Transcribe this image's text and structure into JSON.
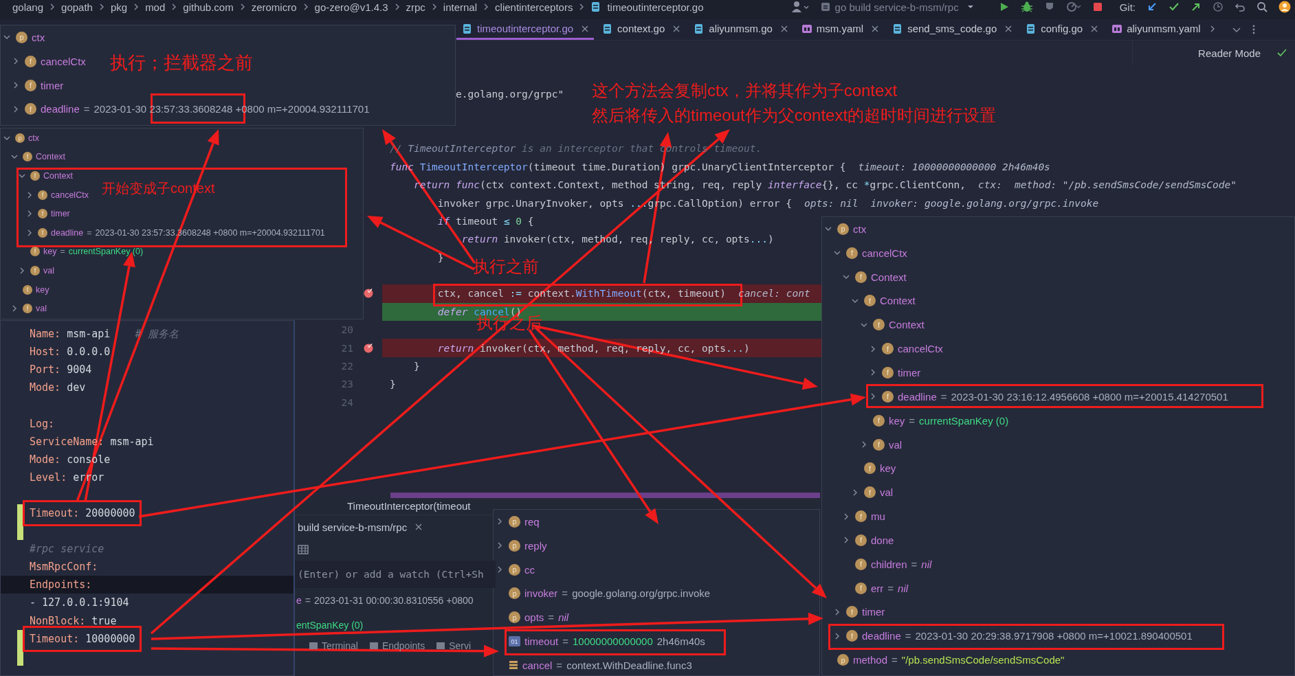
{
  "breadcrumb": [
    {
      "label": "golang",
      "kind": "dir"
    },
    {
      "label": "gopath",
      "kind": "dir"
    },
    {
      "label": "pkg",
      "kind": "dir"
    },
    {
      "label": "mod",
      "kind": "dir"
    },
    {
      "label": "github.com",
      "kind": "dir"
    },
    {
      "label": "zeromicro",
      "kind": "dir"
    },
    {
      "label": "go-zero@v1.4.3",
      "kind": "dir"
    },
    {
      "label": "zrpc",
      "kind": "dir"
    },
    {
      "label": "internal",
      "kind": "dir"
    },
    {
      "label": "clientinterceptors",
      "kind": "dir"
    },
    {
      "label": "timeoutinterceptor.go",
      "kind": "file"
    }
  ],
  "toolbar": {
    "run_config": "go build service-b-msm/rpc",
    "vcs_label": "Git:"
  },
  "tabs": [
    {
      "label": "timeoutinterceptor.go",
      "kind": "go",
      "selected": true,
      "closable": true
    },
    {
      "label": "context.go",
      "kind": "go",
      "selected": false,
      "closable": true
    },
    {
      "label": "aliyunmsm.go",
      "kind": "go",
      "selected": false,
      "closable": true
    },
    {
      "label": "msm.yaml",
      "kind": "yaml",
      "selected": false,
      "closable": true
    },
    {
      "label": "send_sms_code.go",
      "kind": "go",
      "selected": false,
      "closable": true
    },
    {
      "label": "config.go",
      "kind": "go",
      "selected": false,
      "closable": true
    },
    {
      "label": "aliyunmsm.yaml",
      "kind": "yaml",
      "selected": false,
      "closable": false
    }
  ],
  "reader_mode": "Reader Mode",
  "code_lines": [
    {
      "tokens": [
        {
          "text": "           e.golang.org/grpc\"",
          "kind": "p"
        }
      ],
      "breakpoint": false,
      "current": false
    },
    {
      "breakpoint": false,
      "current": false
    },
    {
      "breakpoint": false,
      "current": false
    },
    {
      "tokens": [
        {
          "text": "// ",
          "kind": "c"
        },
        {
          "text": "TimeoutInterceptor",
          "kind": "cd"
        },
        {
          "text": " is an interceptor that controls timeout.",
          "kind": "c"
        }
      ],
      "breakpoint": false,
      "current": false
    },
    {
      "tokens": [
        {
          "text": "func ",
          "kind": "kw"
        },
        {
          "text": "TimeoutInterceptor",
          "kind": "fn"
        },
        {
          "text": "(timeout time.Duration) grpc.UnaryClientInterceptor {",
          "kind": "p"
        }
      ],
      "hints": [
        "timeout: 10000000000000 2h46m40s"
      ],
      "breakpoint": false,
      "current": false
    },
    {
      "tokens": [
        {
          "text": "    return func",
          "kind": "kw"
        },
        {
          "text": "(ctx context.Context, method string, req, reply ",
          "kind": "p"
        },
        {
          "text": "interface",
          "kind": "kw"
        },
        {
          "text": "{}, cc ",
          "kind": "p"
        },
        {
          "text": "*",
          "kind": "op"
        },
        {
          "text": "grpc.ClientConn,",
          "kind": "p"
        }
      ],
      "hints": [
        "ctx:",
        "method: \"/pb.sendSmsCode/sendSmsCode\""
      ],
      "breakpoint": false,
      "current": false
    },
    {
      "tokens": [
        {
          "text": "        invoker grpc.UnaryInvoker, opts ",
          "kind": "p"
        },
        {
          "text": "...",
          "kind": "op"
        },
        {
          "text": "grpc.CallOption) error {",
          "kind": "p"
        }
      ],
      "hints": [
        "opts: nil",
        "invoker: google.golang.org/grpc.invoke"
      ],
      "breakpoint": false,
      "current": false
    },
    {
      "tokens": [
        {
          "text": "        if",
          "kind": "kw"
        },
        {
          "text": " timeout ",
          "kind": "p"
        },
        {
          "text": "≤",
          "kind": "op"
        },
        {
          "text": " 0",
          "kind": "num"
        },
        {
          "text": " {",
          "kind": "p"
        }
      ],
      "breakpoint": false,
      "current": false
    },
    {
      "tokens": [
        {
          "text": "            return",
          "kind": "kw"
        },
        {
          "text": " invoker(ctx, method, req, reply, cc, opts",
          "kind": "p"
        },
        {
          "text": "...",
          "kind": "op"
        },
        {
          "text": ")",
          "kind": "p"
        }
      ],
      "breakpoint": false,
      "current": false
    },
    {
      "tokens": [
        {
          "text": "        }",
          "kind": "p"
        }
      ],
      "breakpoint": false,
      "current": false
    },
    {
      "breakpoint": false,
      "current": false
    },
    {
      "tokens": [
        {
          "text": "        ctx, cancel ",
          "kind": "p"
        },
        {
          "text": ":=",
          "kind": "op"
        },
        {
          "text": " context.",
          "kind": "p"
        },
        {
          "text": "WithTimeout",
          "kind": "fn"
        },
        {
          "text": "(ctx, timeout)",
          "kind": "p"
        }
      ],
      "hints": [
        "cancel: cont"
      ],
      "breakpoint": true,
      "current": false
    },
    {
      "tokens": [
        {
          "text": "        defer ",
          "kind": "kw"
        },
        {
          "text": "cancel",
          "kind": "call"
        },
        {
          "text": "()",
          "kind": "p"
        }
      ],
      "breakpoint": false,
      "current": true
    },
    {
      "number": "20",
      "breakpoint": false,
      "current": false
    },
    {
      "number": "21",
      "tokens": [
        {
          "text": "        return",
          "kind": "kw"
        },
        {
          "text": " invoker(ctx, method, req, reply, cc, opts",
          "kind": "p"
        },
        {
          "text": "...",
          "kind": "op"
        },
        {
          "text": ")",
          "kind": "p"
        }
      ],
      "breakpoint": true,
      "current": false
    },
    {
      "number": "22",
      "tokens": [
        {
          "text": "    }",
          "kind": "p"
        }
      ],
      "breakpoint": false,
      "current": false
    },
    {
      "number": "23",
      "tokens": [
        {
          "text": "}",
          "kind": "p"
        }
      ],
      "breakpoint": false,
      "current": false
    },
    {
      "number": "24",
      "breakpoint": false,
      "current": false
    }
  ],
  "variable_panels": [
    {
      "items": [
        {
          "name": "ctx",
          "badge": "p",
          "kind": "round",
          "expanded": true,
          "children": [
            {
              "name": "cancelCtx",
              "badge": "f",
              "kind": "round",
              "expanded": false
            },
            {
              "name": "timer",
              "badge": "f",
              "kind": "round",
              "expanded": false
            },
            {
              "name": "deadline",
              "badge": "f",
              "kind": "round",
              "expanded": false,
              "value": [
                {
                  "text": "=",
                  "kind": "op"
                },
                {
                  "text": "2023-01-30 23:57:33.3608248 +0800 m=+20004.932111701",
                  "kind": "text"
                }
              ]
            }
          ]
        }
      ]
    },
    {
      "items": [
        {
          "name": "ctx",
          "badge": "p",
          "kind": "round",
          "expanded": true,
          "children": [
            {
              "name": "Context",
              "badge": "f",
              "kind": "round",
              "expanded": true,
              "children": [
                {
                  "name": "Context",
                  "badge": "f",
                  "kind": "round",
                  "expanded": true,
                  "children": [
                    {
                      "name": "cancelCtx",
                      "badge": "f",
                      "kind": "round",
                      "expanded": false
                    },
                    {
                      "name": "timer",
                      "badge": "f",
                      "kind": "round",
                      "expanded": false
                    },
                    {
                      "name": "deadline",
                      "badge": "f",
                      "kind": "round",
                      "expanded": false,
                      "value": [
                        {
                          "text": "=",
                          "kind": "op"
                        },
                        {
                          "text": "2023-01-30 23:57:33.3608248 +0800 m=+20004.932111701",
                          "kind": "text"
                        }
                      ]
                    }
                  ]
                },
                {
                  "name": "key",
                  "badge": "f",
                  "kind": "round",
                  "value": [
                    {
                      "text": "=",
                      "kind": "op"
                    },
                    {
                      "text": "currentSpanKey (0)",
                      "kind": "const"
                    }
                  ]
                },
                {
                  "name": "val",
                  "badge": "f",
                  "kind": "round",
                  "expanded": false
                }
              ]
            },
            {
              "name": "key",
              "badge": "f",
              "kind": "round"
            },
            {
              "name": "val",
              "badge": "f",
              "kind": "round",
              "expanded": false
            }
          ]
        }
      ]
    },
    {
      "items": [
        {
          "name": "req",
          "badge": "p",
          "kind": "round",
          "expanded": false
        },
        {
          "name": "reply",
          "badge": "p",
          "kind": "round",
          "expanded": false
        },
        {
          "name": "cc",
          "badge": "p",
          "kind": "round",
          "expanded": false
        },
        {
          "name": "invoker",
          "badge": "p",
          "kind": "round",
          "value": [
            {
              "text": "=",
              "kind": "op"
            },
            {
              "text": "google.golang.org/grpc.invoke",
              "kind": "text"
            }
          ]
        },
        {
          "name": "opts",
          "badge": "p",
          "kind": "round",
          "value": [
            {
              "text": "=",
              "kind": "op"
            },
            {
              "text": "nil",
              "kind": "nil"
            }
          ]
        },
        {
          "name": "timeout",
          "badge": "01",
          "kind": "square",
          "value": [
            {
              "text": "=",
              "kind": "op"
            },
            {
              "text": "10000000000000",
              "kind": "const"
            },
            {
              "text": "2h46m40s",
              "kind": "text"
            }
          ]
        },
        {
          "name": "cancel",
          "kind": "stack",
          "value": [
            {
              "text": "=",
              "kind": "op"
            },
            {
              "text": "context.WithDeadline.func3",
              "kind": "text"
            }
          ]
        }
      ]
    },
    {
      "items": [
        {
          "name": "ctx",
          "badge": "p",
          "kind": "round",
          "expanded": true,
          "children": [
            {
              "name": "cancelCtx",
              "badge": "f",
              "kind": "round",
              "expanded": true,
              "children": [
                {
                  "name": "Context",
                  "badge": "f",
                  "kind": "round",
                  "expanded": true,
                  "children": [
                    {
                      "name": "Context",
                      "badge": "f",
                      "kind": "round",
                      "expanded": true,
                      "children": [
                        {
                          "name": "Context",
                          "badge": "f",
                          "kind": "round",
                          "expanded": true,
                          "children": [
                            {
                              "name": "cancelCtx",
                              "badge": "f",
                              "kind": "round",
                              "expanded": false
                            },
                            {
                              "name": "timer",
                              "badge": "f",
                              "kind": "round",
                              "expanded": false
                            },
                            {
                              "name": "deadline",
                              "badge": "f",
                              "kind": "round",
                              "expanded": false,
                              "value": [
                                {
                                  "text": "=",
                                  "kind": "op"
                                },
                                {
                                  "text": "2023-01-30 23:16:12.4956608 +0800 m=+20015.414270501",
                                  "kind": "text"
                                }
                              ]
                            }
                          ]
                        },
                        {
                          "name": "key",
                          "badge": "f",
                          "kind": "round",
                          "value": [
                            {
                              "text": "=",
                              "kind": "op"
                            },
                            {
                              "text": "currentSpanKey (0)",
                              "kind": "const"
                            }
                          ]
                        },
                        {
                          "name": "val",
                          "badge": "f",
                          "kind": "round",
                          "expanded": false
                        }
                      ]
                    },
                    {
                      "name": "key",
                      "badge": "f",
                      "kind": "round"
                    },
                    {
                      "name": "val",
                      "badge": "f",
                      "kind": "round",
                      "expanded": false
                    }
                  ]
                },
                {
                  "name": "mu",
                  "badge": "f",
                  "kind": "round",
                  "expanded": false
                },
                {
                  "name": "done",
                  "badge": "f",
                  "kind": "round",
                  "expanded": false
                },
                {
                  "name": "children",
                  "badge": "f",
                  "kind": "round",
                  "value": [
                    {
                      "text": "=",
                      "kind": "op"
                    },
                    {
                      "text": "nil",
                      "kind": "nil"
                    }
                  ]
                },
                {
                  "name": "err",
                  "badge": "f",
                  "kind": "round",
                  "value": [
                    {
                      "text": "=",
                      "kind": "op"
                    },
                    {
                      "text": "nil",
                      "kind": "nil"
                    }
                  ]
                }
              ]
            },
            {
              "name": "timer",
              "badge": "f",
              "kind": "round",
              "expanded": false
            },
            {
              "name": "deadline",
              "badge": "f",
              "kind": "round",
              "expanded": false,
              "value": [
                {
                  "text": "=",
                  "kind": "op"
                },
                {
                  "text": "2023-01-30 20:29:38.9717908 +0800 m=+10021.890400501",
                  "kind": "text"
                }
              ]
            }
          ]
        },
        {
          "name": "method",
          "badge": "p",
          "kind": "round",
          "value": [
            {
              "text": "=",
              "kind": "op"
            },
            {
              "text": "\"/pb.sendSmsCode/sendSmsCode\"",
              "kind": "string"
            }
          ]
        }
      ]
    }
  ],
  "config_lines": [
    {
      "tokens": [
        {
          "text": "Name:",
          "kind": "key"
        },
        {
          "text": " msm-api",
          "kind": "val"
        },
        {
          "text": "    # 服务名",
          "kind": "cmt"
        }
      ],
      "changed": false,
      "current": false
    },
    {
      "tokens": [
        {
          "text": "Host:",
          "kind": "key"
        },
        {
          "text": " 0.0.0.0",
          "kind": "val"
        }
      ],
      "changed": false,
      "current": false
    },
    {
      "tokens": [
        {
          "text": "Port:",
          "kind": "key"
        },
        {
          "text": " 9004",
          "kind": "val"
        }
      ],
      "changed": false,
      "current": false
    },
    {
      "tokens": [
        {
          "text": "Mode:",
          "kind": "key"
        },
        {
          "text": " dev",
          "kind": "val"
        }
      ],
      "changed": false,
      "current": false
    },
    {
      "changed": false,
      "current": false
    },
    {
      "tokens": [
        {
          "text": "Log:",
          "kind": "key"
        }
      ],
      "changed": false,
      "current": false
    },
    {
      "tokens": [
        {
          "text": "  ServiceName:",
          "kind": "key"
        },
        {
          "text": " msm-api",
          "kind": "val"
        }
      ],
      "changed": false,
      "current": false
    },
    {
      "tokens": [
        {
          "text": "  Mode:",
          "kind": "key"
        },
        {
          "text": " console",
          "kind": "val"
        }
      ],
      "changed": false,
      "current": false
    },
    {
      "tokens": [
        {
          "text": "  Level:",
          "kind": "key"
        },
        {
          "text": " error",
          "kind": "val"
        }
      ],
      "changed": false,
      "current": false
    },
    {
      "changed": false,
      "current": false
    },
    {
      "tokens": [
        {
          "text": "Timeout:",
          "kind": "key"
        },
        {
          "text": " 20000000",
          "kind": "val"
        }
      ],
      "changed": true,
      "current": false,
      "framed": true
    },
    {
      "changed": true,
      "current": false
    },
    {
      "tokens": [
        {
          "text": "#rpc service",
          "kind": "cmt"
        }
      ],
      "changed": false,
      "current": false
    },
    {
      "tokens": [
        {
          "text": "MsmRpcConf:",
          "kind": "key"
        }
      ],
      "changed": false,
      "current": false
    },
    {
      "tokens": [
        {
          "text": "  Endpoints:",
          "kind": "key"
        }
      ],
      "changed": false,
      "current": true
    },
    {
      "tokens": [
        {
          "text": "    - 127.0.0.1:9104",
          "kind": "val"
        }
      ],
      "changed": false,
      "current": false
    },
    {
      "tokens": [
        {
          "text": "  NonBlock:",
          "kind": "key"
        },
        {
          "text": " true",
          "kind": "val"
        }
      ],
      "changed": false,
      "current": false
    },
    {
      "tokens": [
        {
          "text": "  Timeout:",
          "kind": "key"
        },
        {
          "text": " 10000000",
          "kind": "val"
        }
      ],
      "changed": true,
      "current": false,
      "framed": true
    },
    {
      "changed": true,
      "current": false
    }
  ],
  "run_window": {
    "location": "TimeoutInterceptor(timeout",
    "tab": "build service-b-msm/rpc",
    "watch_hint": "(Enter) or add a watch (Ctrl+Sh",
    "variables": [
      {
        "name": "e",
        "value": [
          {
            "text": "=",
            "kind": "op"
          },
          {
            "text": "2023-01-31 00:00:30.8310556 +0800",
            "kind": "text"
          }
        ]
      },
      {
        "value": [
          {
            "text": "entSpanKey (0)",
            "kind": "const"
          }
        ]
      }
    ],
    "tool_tabs": [
      "Terminal",
      "Endpoints",
      "Servi"
    ]
  },
  "annotations": [
    "执行；拦截器之前",
    "开始变成子context",
    "这个方法会复制ctx，并将其作为子context",
    "然后将传入的timeout作为父context的超时时间进行设置",
    "执行之前",
    "执行之后"
  ]
}
